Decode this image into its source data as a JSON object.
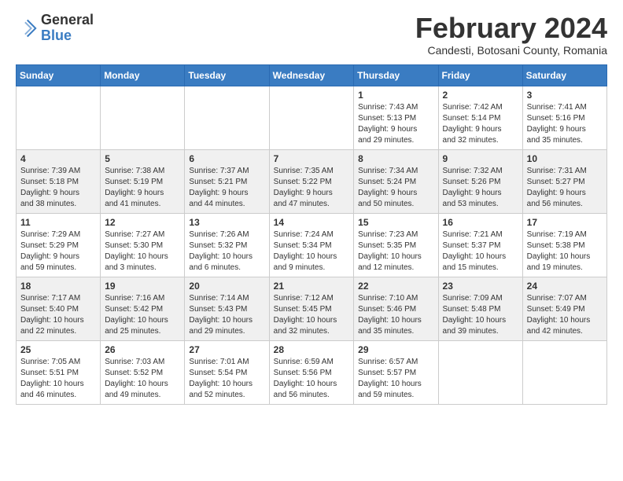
{
  "header": {
    "logo_line1": "General",
    "logo_line2": "Blue",
    "month_title": "February 2024",
    "subtitle": "Candesti, Botosani County, Romania"
  },
  "days_of_week": [
    "Sunday",
    "Monday",
    "Tuesday",
    "Wednesday",
    "Thursday",
    "Friday",
    "Saturday"
  ],
  "weeks": [
    [
      {
        "day": "",
        "info": ""
      },
      {
        "day": "",
        "info": ""
      },
      {
        "day": "",
        "info": ""
      },
      {
        "day": "",
        "info": ""
      },
      {
        "day": "1",
        "info": "Sunrise: 7:43 AM\nSunset: 5:13 PM\nDaylight: 9 hours\nand 29 minutes."
      },
      {
        "day": "2",
        "info": "Sunrise: 7:42 AM\nSunset: 5:14 PM\nDaylight: 9 hours\nand 32 minutes."
      },
      {
        "day": "3",
        "info": "Sunrise: 7:41 AM\nSunset: 5:16 PM\nDaylight: 9 hours\nand 35 minutes."
      }
    ],
    [
      {
        "day": "4",
        "info": "Sunrise: 7:39 AM\nSunset: 5:18 PM\nDaylight: 9 hours\nand 38 minutes."
      },
      {
        "day": "5",
        "info": "Sunrise: 7:38 AM\nSunset: 5:19 PM\nDaylight: 9 hours\nand 41 minutes."
      },
      {
        "day": "6",
        "info": "Sunrise: 7:37 AM\nSunset: 5:21 PM\nDaylight: 9 hours\nand 44 minutes."
      },
      {
        "day": "7",
        "info": "Sunrise: 7:35 AM\nSunset: 5:22 PM\nDaylight: 9 hours\nand 47 minutes."
      },
      {
        "day": "8",
        "info": "Sunrise: 7:34 AM\nSunset: 5:24 PM\nDaylight: 9 hours\nand 50 minutes."
      },
      {
        "day": "9",
        "info": "Sunrise: 7:32 AM\nSunset: 5:26 PM\nDaylight: 9 hours\nand 53 minutes."
      },
      {
        "day": "10",
        "info": "Sunrise: 7:31 AM\nSunset: 5:27 PM\nDaylight: 9 hours\nand 56 minutes."
      }
    ],
    [
      {
        "day": "11",
        "info": "Sunrise: 7:29 AM\nSunset: 5:29 PM\nDaylight: 9 hours\nand 59 minutes."
      },
      {
        "day": "12",
        "info": "Sunrise: 7:27 AM\nSunset: 5:30 PM\nDaylight: 10 hours\nand 3 minutes."
      },
      {
        "day": "13",
        "info": "Sunrise: 7:26 AM\nSunset: 5:32 PM\nDaylight: 10 hours\nand 6 minutes."
      },
      {
        "day": "14",
        "info": "Sunrise: 7:24 AM\nSunset: 5:34 PM\nDaylight: 10 hours\nand 9 minutes."
      },
      {
        "day": "15",
        "info": "Sunrise: 7:23 AM\nSunset: 5:35 PM\nDaylight: 10 hours\nand 12 minutes."
      },
      {
        "day": "16",
        "info": "Sunrise: 7:21 AM\nSunset: 5:37 PM\nDaylight: 10 hours\nand 15 minutes."
      },
      {
        "day": "17",
        "info": "Sunrise: 7:19 AM\nSunset: 5:38 PM\nDaylight: 10 hours\nand 19 minutes."
      }
    ],
    [
      {
        "day": "18",
        "info": "Sunrise: 7:17 AM\nSunset: 5:40 PM\nDaylight: 10 hours\nand 22 minutes."
      },
      {
        "day": "19",
        "info": "Sunrise: 7:16 AM\nSunset: 5:42 PM\nDaylight: 10 hours\nand 25 minutes."
      },
      {
        "day": "20",
        "info": "Sunrise: 7:14 AM\nSunset: 5:43 PM\nDaylight: 10 hours\nand 29 minutes."
      },
      {
        "day": "21",
        "info": "Sunrise: 7:12 AM\nSunset: 5:45 PM\nDaylight: 10 hours\nand 32 minutes."
      },
      {
        "day": "22",
        "info": "Sunrise: 7:10 AM\nSunset: 5:46 PM\nDaylight: 10 hours\nand 35 minutes."
      },
      {
        "day": "23",
        "info": "Sunrise: 7:09 AM\nSunset: 5:48 PM\nDaylight: 10 hours\nand 39 minutes."
      },
      {
        "day": "24",
        "info": "Sunrise: 7:07 AM\nSunset: 5:49 PM\nDaylight: 10 hours\nand 42 minutes."
      }
    ],
    [
      {
        "day": "25",
        "info": "Sunrise: 7:05 AM\nSunset: 5:51 PM\nDaylight: 10 hours\nand 46 minutes."
      },
      {
        "day": "26",
        "info": "Sunrise: 7:03 AM\nSunset: 5:52 PM\nDaylight: 10 hours\nand 49 minutes."
      },
      {
        "day": "27",
        "info": "Sunrise: 7:01 AM\nSunset: 5:54 PM\nDaylight: 10 hours\nand 52 minutes."
      },
      {
        "day": "28",
        "info": "Sunrise: 6:59 AM\nSunset: 5:56 PM\nDaylight: 10 hours\nand 56 minutes."
      },
      {
        "day": "29",
        "info": "Sunrise: 6:57 AM\nSunset: 5:57 PM\nDaylight: 10 hours\nand 59 minutes."
      },
      {
        "day": "",
        "info": ""
      },
      {
        "day": "",
        "info": ""
      }
    ]
  ]
}
